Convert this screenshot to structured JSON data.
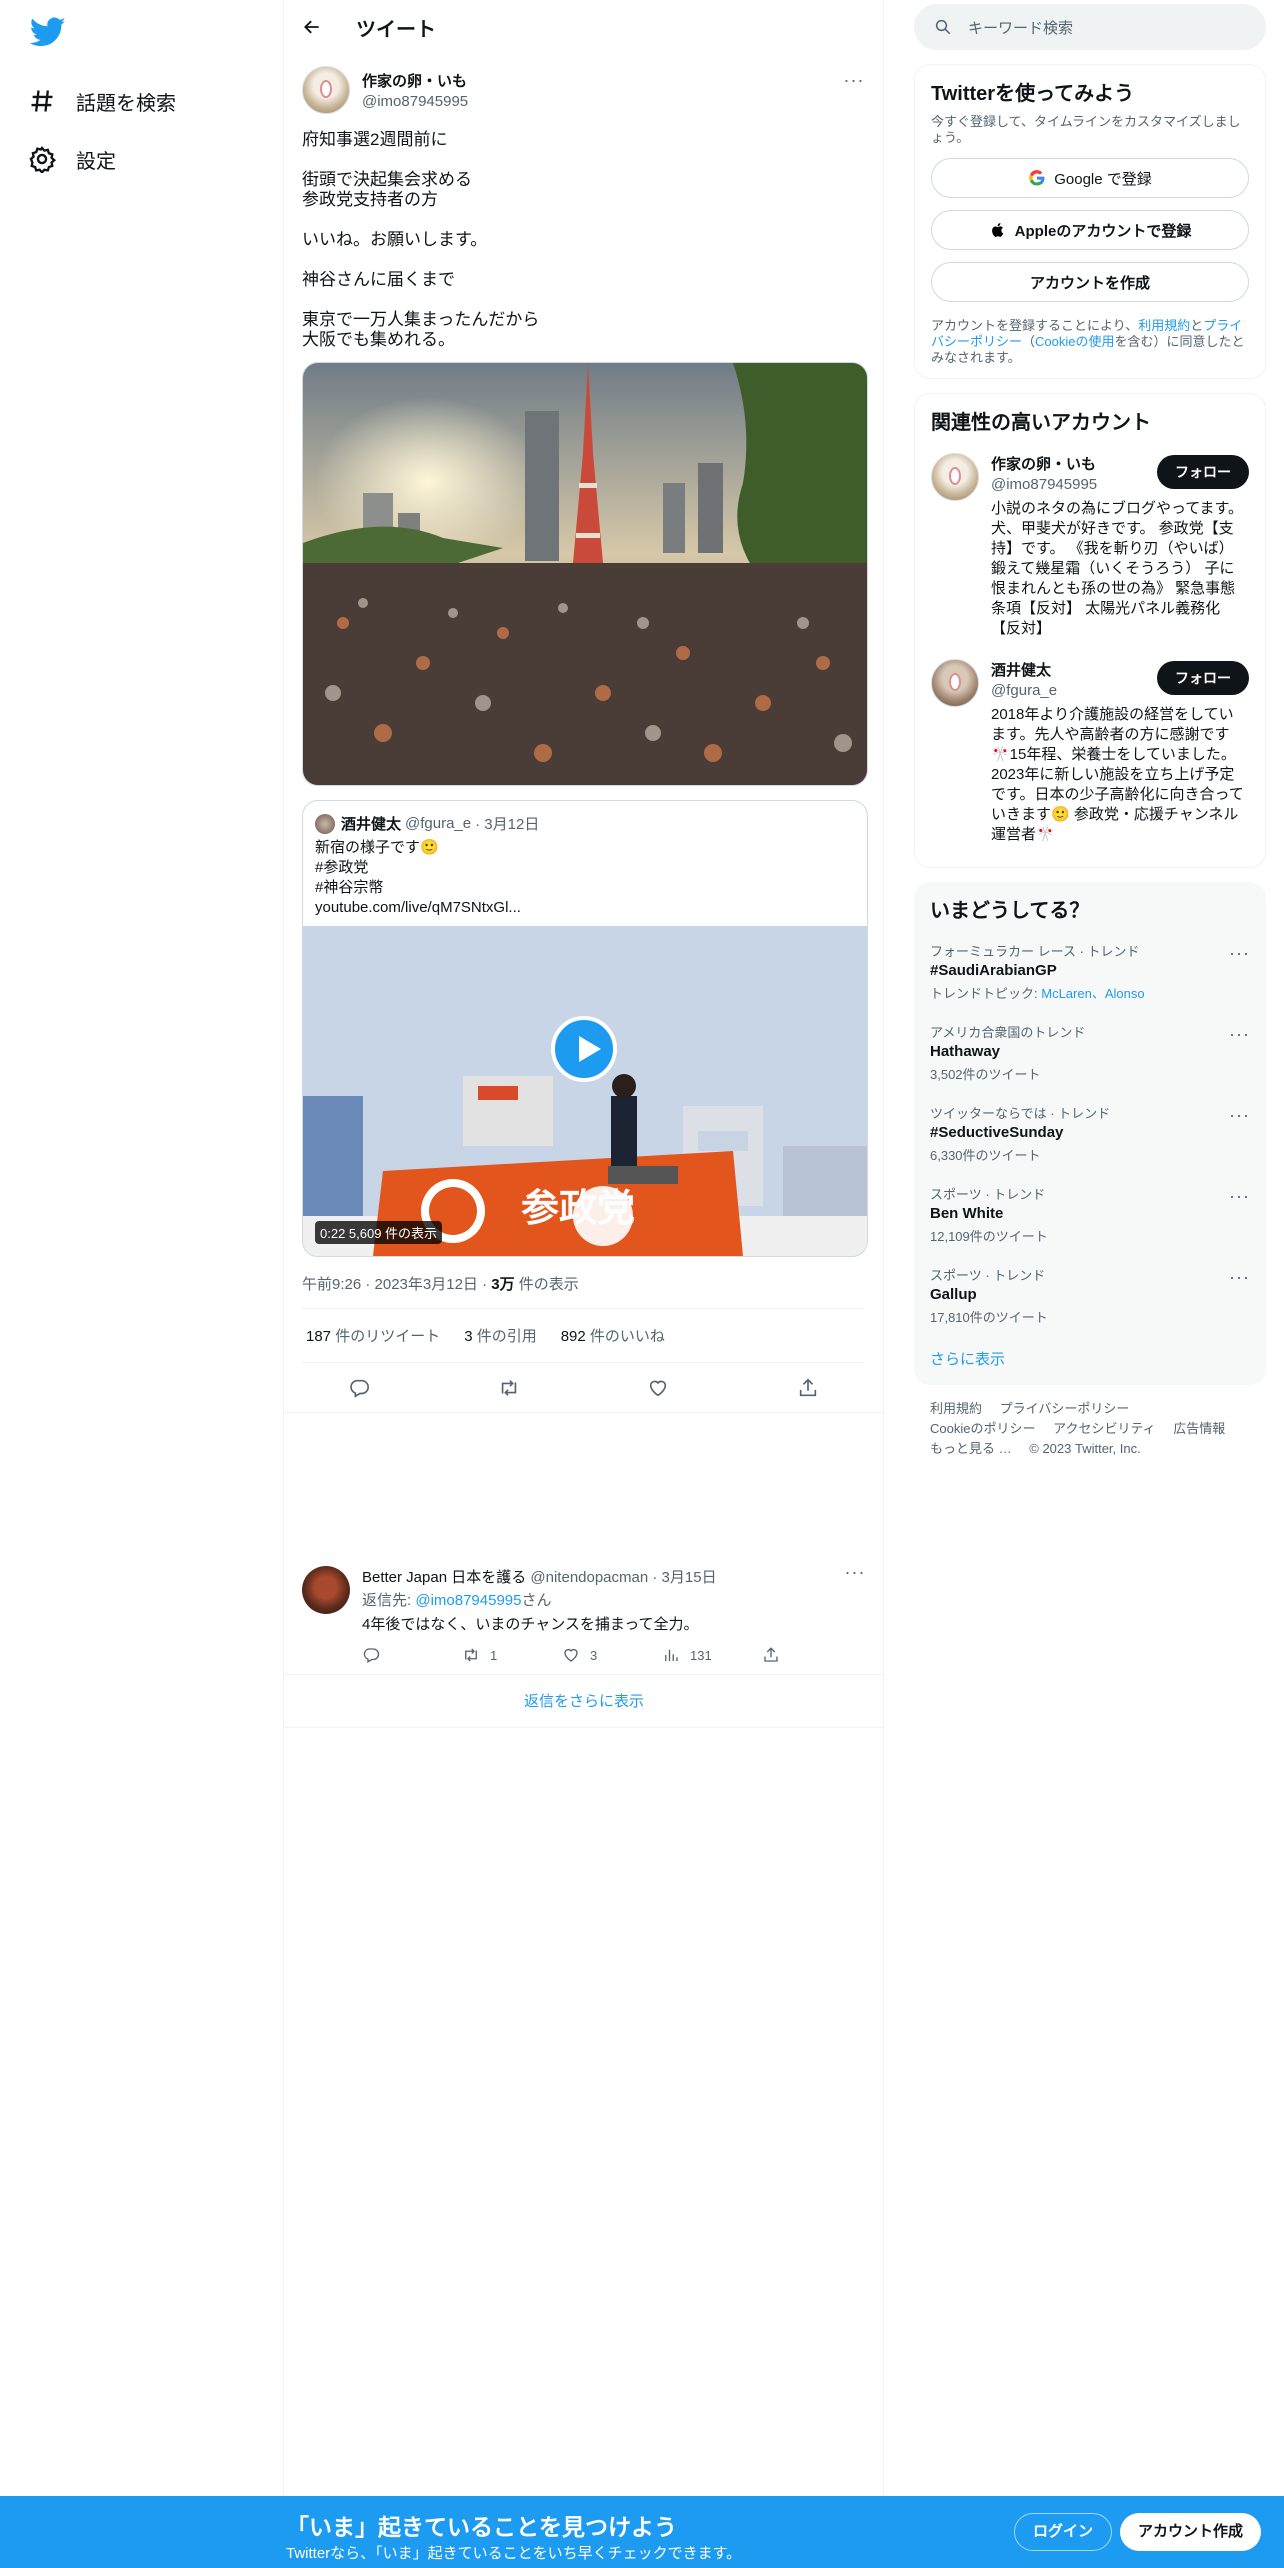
{
  "nav": {
    "logo": "twitter-bird-icon",
    "items": [
      {
        "label": "話題を検索",
        "icon": "hash-icon"
      },
      {
        "label": "設定",
        "icon": "gear-icon"
      }
    ]
  },
  "header": {
    "title": "ツイート"
  },
  "tweet": {
    "author_name": "作家の卵・いも",
    "author_handle": "@imo87945995",
    "body": [
      "府知事選2週間前に",
      "街頭で決起集会求める\n参政党支持者の方",
      "いいね。お願いします。",
      "神谷さんに届くまで",
      "東京で一万人集まったんだから\n大阪でも集めれる。"
    ],
    "quote": {
      "name": "酒井健太",
      "handle": "@fgura_e",
      "date": "· 3月12日",
      "lines": [
        "新宿の様子です🙂",
        "#参政党",
        "#神谷宗幣",
        "youtube.com/live/qM7SNtxGl..."
      ],
      "video_caption": "0:22  5,609 件の表示",
      "banner": "参政党"
    },
    "time": "午前9:26 · 2023年3月12日 · ",
    "views_num": "3万",
    "views_label": " 件の表示",
    "retweets_num": "187",
    "retweets_label": " 件のリツイート",
    "quotes_num": "3",
    "quotes_label": " 件の引用",
    "likes_num": "892",
    "likes_label": " 件のいいね"
  },
  "reply": {
    "name": "Better Japan 日本を護る",
    "handle": "@nitendopacman",
    "date": "· 3月15日",
    "to_prefix": "返信先: ",
    "to_handle": "@imo87945995",
    "to_suffix": "さん",
    "text": "4年後ではなく、いまのチャンスを捕まって全力。",
    "retweets": "1",
    "likes": "3",
    "views": "131"
  },
  "show_more_replies": "返信をさらに表示",
  "search": {
    "placeholder": "キーワード検索"
  },
  "signup_box": {
    "title": "Twitterを使ってみよう",
    "subtitle": "今すぐ登録して、タイムラインをカスタマイズしましょう。",
    "google": "Google で登録",
    "apple": "Appleのアカウントで登録",
    "create": "アカウントを作成",
    "legal_a": "アカウントを登録することにより、",
    "legal_terms": "利用規約",
    "legal_b": "と",
    "legal_privacy": "プライバシーポリシー",
    "legal_c": "（",
    "legal_cookie": "Cookieの使用",
    "legal_d": "を含む）に同意したとみなされます。"
  },
  "related": {
    "title": "関連性の高いアカウント",
    "follow": "フォロー",
    "accounts": [
      {
        "name": "作家の卵・いも",
        "handle": "@imo87945995",
        "bio": "小説のネタの為にブログやってます。犬、甲斐犬が好きです。 参政党【支持】です。 《我を斬り刃（やいば）鍛えて幾星霜（いくそうろう） 子に恨まれんとも孫の世の為》 緊急事態条項【反対】 太陽光パネル義務化【反対】"
      },
      {
        "name": "酒井健太",
        "handle": "@fgura_e",
        "bio": "2018年より介護施設の経営をしています。先人や高齢者の方に感謝です🎌15年程、栄養士をしていました。2023年に新しい施設を立ち上げ予定です。日本の少子高齢化に向き合っていきます🙂 参政党・応援チャンネル運営者🎌"
      }
    ]
  },
  "trends": {
    "title": "いまどうしてる？",
    "items": [
      {
        "context": "フォーミュラカー レース · トレンド",
        "name": "#SaudiArabianGP",
        "extra_label": "トレンドトピック: ",
        "extra_links": "McLaren、Alonso"
      },
      {
        "context": "アメリカ合衆国のトレンド",
        "name": "Hathaway",
        "count": "3,502件のツイート"
      },
      {
        "context": "ツイッターならでは · トレンド",
        "name": "#SeductiveSunday",
        "count": "6,330件のツイート"
      },
      {
        "context": "スポーツ · トレンド",
        "name": "Ben White",
        "count": "12,109件のツイート"
      },
      {
        "context": "スポーツ · トレンド",
        "name": "Gallup",
        "count": "17,810件のツイート"
      }
    ],
    "show_more": "さらに表示"
  },
  "footer": {
    "terms": "利用規約",
    "privacy": "プライバシーポリシー",
    "cookie": "Cookieのポリシー",
    "access": "アクセシビリティ",
    "ads": "広告情報",
    "more": "もっと見る …",
    "copyright": "© 2023 Twitter, Inc."
  },
  "bottom_bar": {
    "title": "「いま」起きていることを見つけよう",
    "subtitle": "Twitterなら、「いま」起きていることをいち早くチェックできます。",
    "login": "ログイン",
    "signup": "アカウント作成"
  },
  "colors": {
    "accent": "#1d9bf0",
    "text": "#0f1419",
    "secondary": "#536471"
  }
}
